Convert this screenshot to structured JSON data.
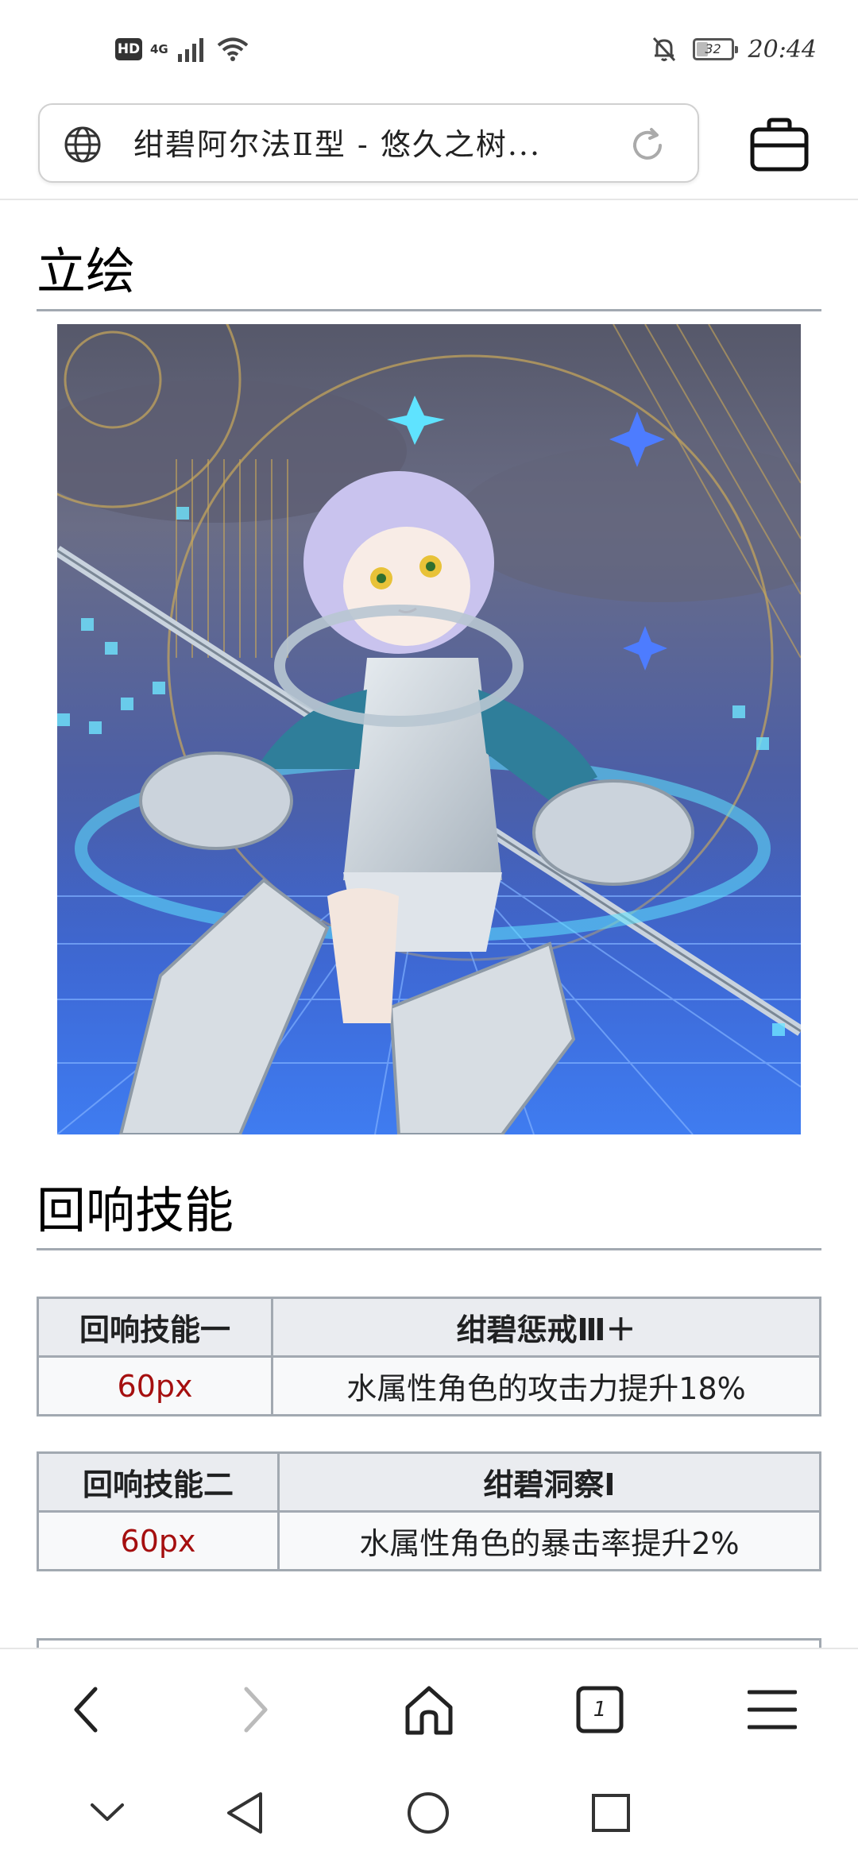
{
  "status_bar": {
    "hd_label": "HD",
    "network_label": "4G",
    "battery_level": "32",
    "time": "20:44"
  },
  "address_bar": {
    "url_text": "绀碧阿尔法Ⅱ型 - 悠久之树..."
  },
  "sections": {
    "portrait_heading": "立绘",
    "echo_heading": "回响技能"
  },
  "echo_skills": [
    {
      "slot_label": "回响技能一",
      "skill_name": "绀碧惩戒Ⅲ＋",
      "size_label": "60px",
      "description": "水属性角色的攻击力提升18%"
    },
    {
      "slot_label": "回响技能二",
      "skill_name": "绀碧洞察Ⅰ",
      "size_label": "60px",
      "description": "水属性角色的暴击率提升2%"
    }
  ],
  "colors": {
    "table_border": "#a2a9b1",
    "table_header_bg": "#eaecf0",
    "table_cell_bg": "#f8f9fa",
    "red_text": "#a50f0f"
  },
  "icons": {
    "status": [
      "hd-icon",
      "signal-icon",
      "wifi-icon",
      "mute-bell-icon",
      "battery-icon"
    ],
    "address": [
      "globe-icon",
      "reload-icon",
      "bag-icon"
    ],
    "toolbar": [
      "back-icon",
      "forward-icon",
      "home-icon",
      "tabs-icon",
      "menu-icon"
    ],
    "system_nav": [
      "collapse-icon",
      "nav-back-icon",
      "nav-home-icon",
      "nav-recents-icon"
    ]
  },
  "toolbar": {
    "tab_count": "1"
  }
}
